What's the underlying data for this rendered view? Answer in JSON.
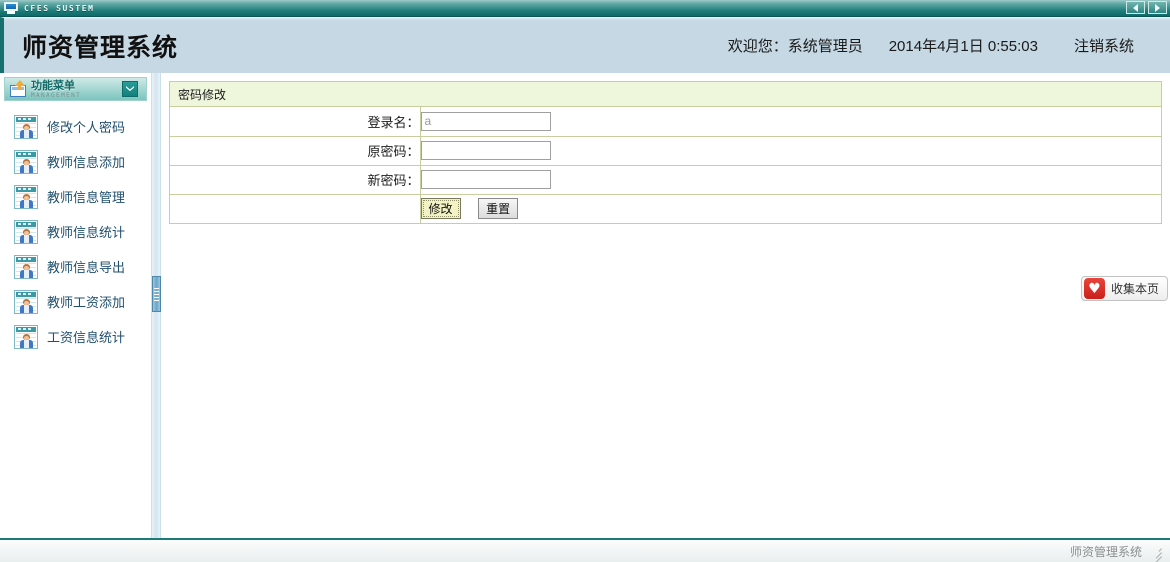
{
  "titlebar": {
    "app_name": "CFES SUSTEM",
    "icon": "monitor-icon",
    "prev_label": "◀",
    "next_label": "▶"
  },
  "header": {
    "title": "师资管理系统",
    "welcome": "欢迎您：系统管理员",
    "datetime": "2014年4月1日  0:55:03",
    "logout": "注销系统"
  },
  "sidebar": {
    "menu_title": "功能菜单",
    "menu_subtitle": "MANAGEMENT",
    "items": [
      {
        "label": "修改个人密码"
      },
      {
        "label": "教师信息添加"
      },
      {
        "label": "教师信息管理"
      },
      {
        "label": "教师信息统计"
      },
      {
        "label": "教师信息导出"
      },
      {
        "label": "教师工资添加"
      },
      {
        "label": "工资信息统计"
      }
    ]
  },
  "main": {
    "panel_title": "密码修改",
    "fields": [
      {
        "label": "登录名：",
        "value": "a",
        "type": "text",
        "readonly": true
      },
      {
        "label": "原密码：",
        "value": "",
        "type": "password",
        "readonly": false
      },
      {
        "label": "新密码：",
        "value": "",
        "type": "password",
        "readonly": false
      }
    ],
    "submit_label": "修改",
    "reset_label": "重置"
  },
  "collect": {
    "icon_glyph": "♥",
    "label": "收集本页"
  },
  "footer": {
    "text": "师资管理系统"
  },
  "colors": {
    "titlebar_teal": "#1c7a77",
    "header_blue": "#c5d8e4",
    "panel_border": "#c8cf9e",
    "panel_head_bg": "#eef6dc",
    "menu_label": "#20506e",
    "accent_red": "#c9201a",
    "primary_btn_bg": "#f2f2c4"
  }
}
